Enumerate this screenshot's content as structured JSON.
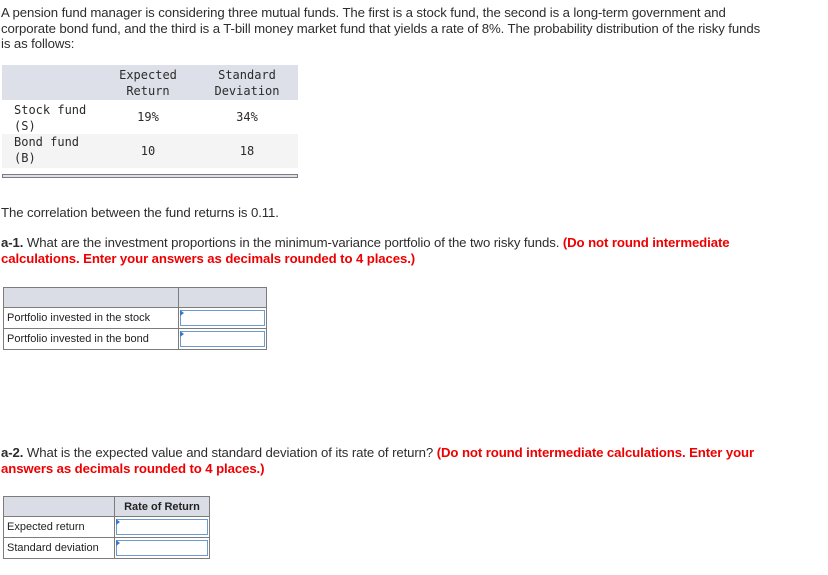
{
  "intro": {
    "line1": "A pension fund manager is considering three mutual funds. The first is a stock fund, the second is a long-term government and",
    "line2": "corporate bond fund, and the third is a T-bill money market fund that yields a rate of 8%. The probability distribution of the risky funds",
    "line3": "is as follows:"
  },
  "fund_table": {
    "headers": [
      "",
      "Expected\nReturn",
      "Standard\nDeviation"
    ],
    "header_expected_line1": "Expected",
    "header_expected_line2": "Return",
    "header_std_line1": "Standard",
    "header_std_line2": "Deviation",
    "rows": [
      {
        "name_line1": "Stock fund",
        "name_line2": "(S)",
        "expected_return": "19%",
        "std_dev": "34%"
      },
      {
        "name_line1": "Bond fund",
        "name_line2": "(B)",
        "expected_return": "10",
        "std_dev": "18"
      }
    ]
  },
  "correlation_text": "The correlation between the fund returns is 0.11.",
  "part_a1": {
    "label": "a-1.",
    "question": " What are the investment proportions in the minimum-variance portfolio of the two risky funds. ",
    "instruction_line1": "(Do not round intermediate",
    "instruction_line2": "calculations. Enter your answers as decimals rounded to 4 places.)",
    "table": {
      "header": [
        "",
        ""
      ],
      "rows": [
        {
          "label": "Portfolio invested in the stock",
          "value": ""
        },
        {
          "label": "Portfolio invested in the bond",
          "value": ""
        }
      ]
    }
  },
  "part_a2": {
    "label": "a-2.",
    "question": " What is the expected value and standard deviation of its rate of return? ",
    "instruction_line1": "(Do not round intermediate calculations. Enter your",
    "instruction_line2": "answers as decimals rounded to 4 places.)",
    "table": {
      "header": [
        "",
        "Rate of Return"
      ],
      "rows": [
        {
          "label": "Expected return",
          "value": ""
        },
        {
          "label": "Standard deviation",
          "value": ""
        }
      ]
    }
  }
}
